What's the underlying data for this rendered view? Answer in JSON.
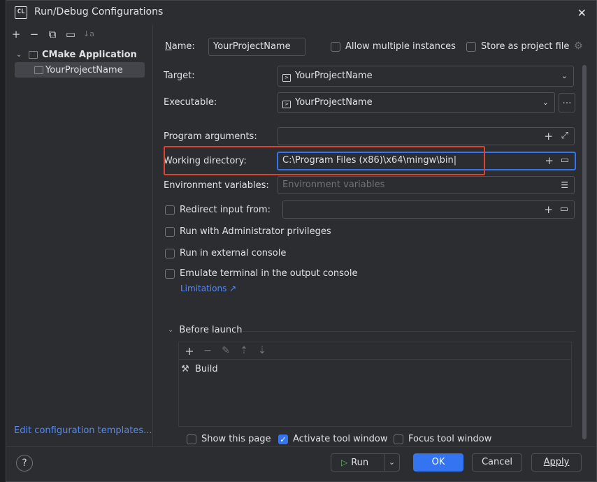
{
  "window": {
    "title": "Run/Debug Configurations",
    "app_icon": "CL"
  },
  "toolbar": {
    "add": "+",
    "remove": "−",
    "copy": "⧉",
    "folder": "▭",
    "sort": "↓a"
  },
  "tree": {
    "group_label": "CMake Application",
    "item_label": "YourProjectName"
  },
  "left_footer": {
    "edit_templates": "Edit configuration templates..."
  },
  "form": {
    "name_label": "Name:",
    "name_value": "YourProjectName",
    "allow_multiple": "Allow multiple instances",
    "store_as_project": "Store as project file",
    "target_label": "Target:",
    "target_value": "YourProjectName",
    "executable_label": "Executable:",
    "executable_value": "YourProjectName",
    "program_args_label": "Program arguments:",
    "working_dir_label": "Working directory:",
    "working_dir_value": "C:\\Program Files (x86)\\x64\\mingw\\bin",
    "env_vars_label": "Environment variables:",
    "env_vars_placeholder": "Environment variables",
    "redirect_input": "Redirect input from:",
    "run_admin": "Run with Administrator privileges",
    "run_external": "Run in external console",
    "emulate_terminal": "Emulate terminal in the output console",
    "limitations": "Limitations ↗"
  },
  "before_launch": {
    "header": "Before launch",
    "item": "Build"
  },
  "bottom_options": {
    "show_page": "Show this page",
    "activate_tool": "Activate tool window",
    "focus_tool": "Focus tool window"
  },
  "buttons": {
    "help": "?",
    "run": "Run",
    "ok": "OK",
    "cancel": "Cancel",
    "apply": "Apply"
  },
  "colors": {
    "accent": "#3574f0",
    "highlight_box": "#e0422d",
    "link": "#548af7"
  }
}
